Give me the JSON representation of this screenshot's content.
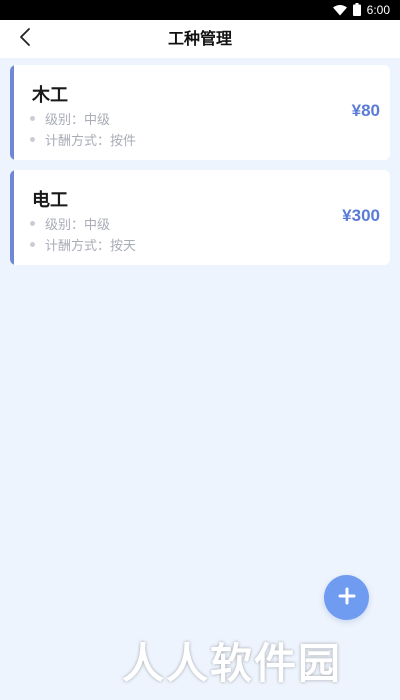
{
  "status_bar": {
    "time": "6:00",
    "icons": [
      "wifi-icon",
      "battery-icon"
    ]
  },
  "header": {
    "title": "工种管理",
    "back_icon": "chevron-left-icon"
  },
  "jobs": [
    {
      "name": "木工",
      "level": "级别：中级",
      "pay_method": "计酬方式：按件",
      "price": "¥80"
    },
    {
      "name": "电工",
      "level": "级别：中级",
      "pay_method": "计酬方式：按天",
      "price": "¥300"
    }
  ],
  "fab": {
    "icon": "plus-icon"
  },
  "watermark": "人人软件园",
  "colors": {
    "background": "#eef4fd",
    "accent": "#6e88d6",
    "price": "#5a7bd6",
    "fab": "#6f9bf0"
  }
}
